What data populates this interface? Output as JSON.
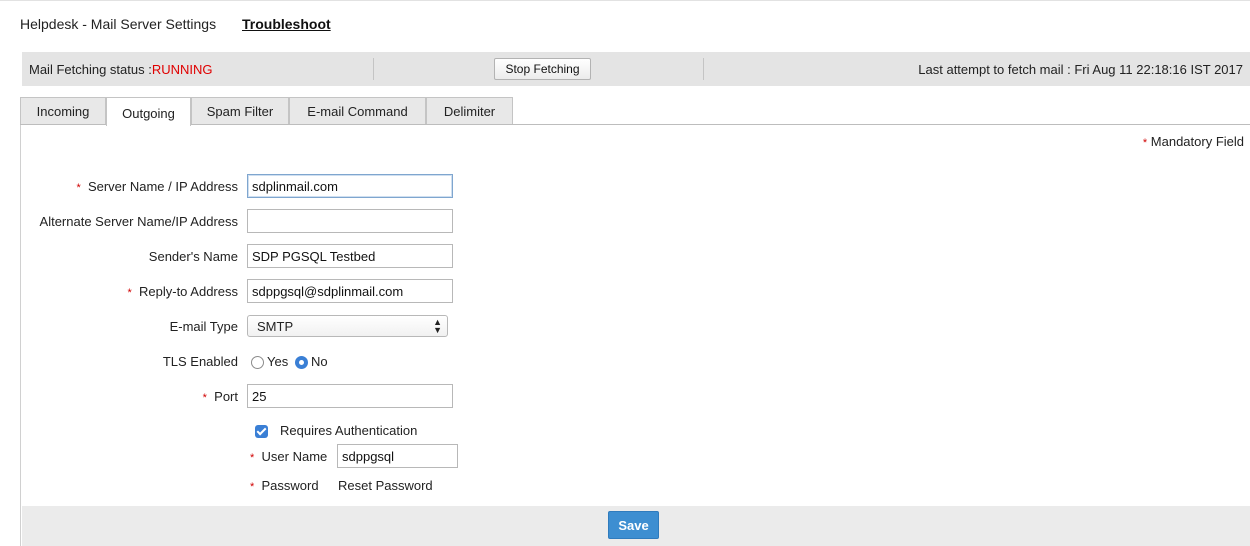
{
  "header": {
    "title": "Helpdesk - Mail Server Settings",
    "troubleshoot_link": "Troubleshoot"
  },
  "status_bar": {
    "label": "Mail Fetching status :",
    "value": "RUNNING",
    "value_color": "#e00000",
    "stop_button": "Stop Fetching",
    "last_attempt": "Last attempt to fetch mail : Fri Aug 11 22:18:16 IST 2017"
  },
  "tabs": [
    {
      "label": "Incoming",
      "active": false
    },
    {
      "label": "Outgoing",
      "active": true
    },
    {
      "label": "Spam Filter",
      "active": false
    },
    {
      "label": "E-mail Command",
      "active": false
    },
    {
      "label": "Delimiter",
      "active": false
    }
  ],
  "form": {
    "mandatory_note": "Mandatory Field",
    "required_marker": "*",
    "server_name": {
      "label": "Server Name / IP Address",
      "value": "sdplinmail.com",
      "required": true
    },
    "alt_server": {
      "label": "Alternate Server Name/IP Address",
      "value": "",
      "required": false
    },
    "sender_name": {
      "label": "Sender's Name",
      "value": "SDP PGSQL Testbed",
      "required": false
    },
    "reply_to": {
      "label": "Reply-to Address",
      "value": "sdppgsql@sdplinmail.com",
      "required": true
    },
    "email_type": {
      "label": "E-mail Type",
      "value": "SMTP"
    },
    "tls": {
      "label": "TLS Enabled",
      "yes": "Yes",
      "no": "No",
      "selected": "No"
    },
    "port": {
      "label": "Port",
      "value": "25",
      "required": true
    },
    "requires_auth": {
      "label": "Requires Authentication",
      "checked": true
    },
    "user_name": {
      "label": "User Name",
      "value": "sdppgsql",
      "required": true
    },
    "password": {
      "label": "Password",
      "reset_link": "Reset Password",
      "required": true
    }
  },
  "footer": {
    "save_button": "Save"
  },
  "colors": {
    "accent": "#3d8ed1",
    "status_bar_bg": "#e4e4e4",
    "required_star": "#d00000"
  }
}
